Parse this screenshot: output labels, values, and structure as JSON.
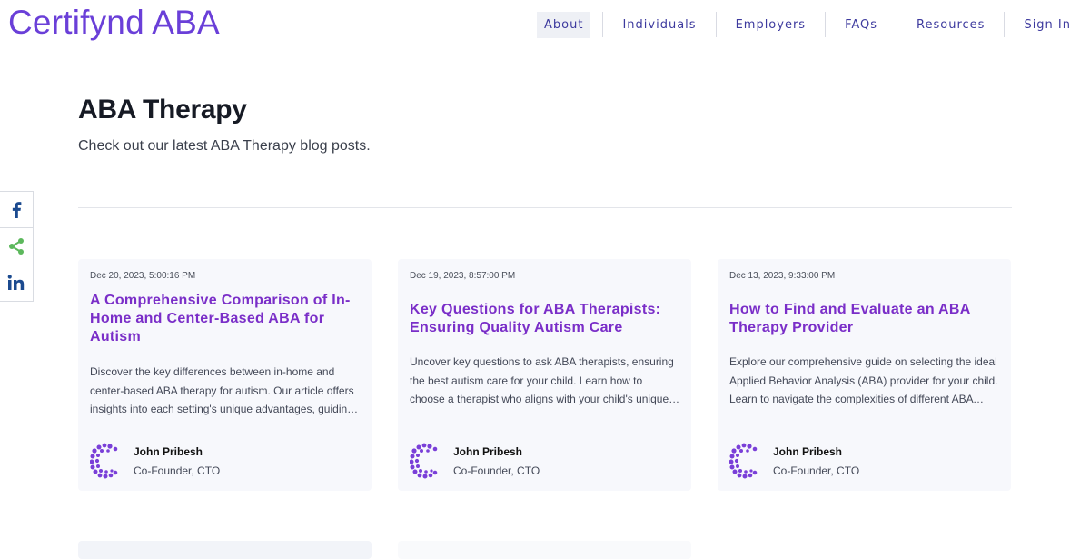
{
  "header": {
    "logo": "Certifynd ABA",
    "nav": [
      {
        "label": "About",
        "active": true
      },
      {
        "label": "Individuals"
      },
      {
        "label": "Employers"
      },
      {
        "label": "FAQs"
      },
      {
        "label": "Resources"
      },
      {
        "label": "Sign In"
      }
    ]
  },
  "page": {
    "title": "ABA Therapy",
    "subtitle": "Check out our latest ABA Therapy blog posts."
  },
  "share": {
    "icons": [
      "facebook-icon",
      "share-icon",
      "linkedin-icon"
    ],
    "colors": {
      "facebook": "#1b4a8f",
      "share": "#5cb85c",
      "linkedin": "#1b4a8f"
    }
  },
  "posts": [
    {
      "date": "Dec 20, 2023, 5:00:16 PM",
      "title": "A Comprehensive Comparison of In-Home and Center-Based ABA for Autism",
      "excerpt": "Discover the key differences between in-home and center-based ABA therapy for autism. Our article offers insights into each setting's unique advantages, guiding parents to make the best choice for their child.",
      "author": "John Pribesh",
      "role": "Co-Founder, CTO"
    },
    {
      "date": "Dec 19, 2023, 8:57:00 PM",
      "title": "Key Questions for ABA Therapists: Ensuring Quality Autism Care",
      "excerpt": "Uncover key questions to ask ABA therapists, ensuring the best autism care for your child. Learn how to choose a therapist who aligns with your child's unique needs for optimal growth.",
      "author": "John Pribesh",
      "role": "Co-Founder, CTO"
    },
    {
      "date": "Dec 13, 2023, 9:33:00 PM",
      "title": "How to Find and Evaluate an ABA Therapy Provider",
      "excerpt": "Explore our comprehensive guide on selecting the ideal Applied Behavior Analysis (ABA) provider for your child. Learn to navigate the complexities of different ABA approaches with confidence.",
      "author": "John Pribesh",
      "role": "Co-Founder, CTO"
    }
  ],
  "colors": {
    "brand": "#6a3fd8",
    "title": "#7a2ec8",
    "nav": "#3d3a9e"
  }
}
